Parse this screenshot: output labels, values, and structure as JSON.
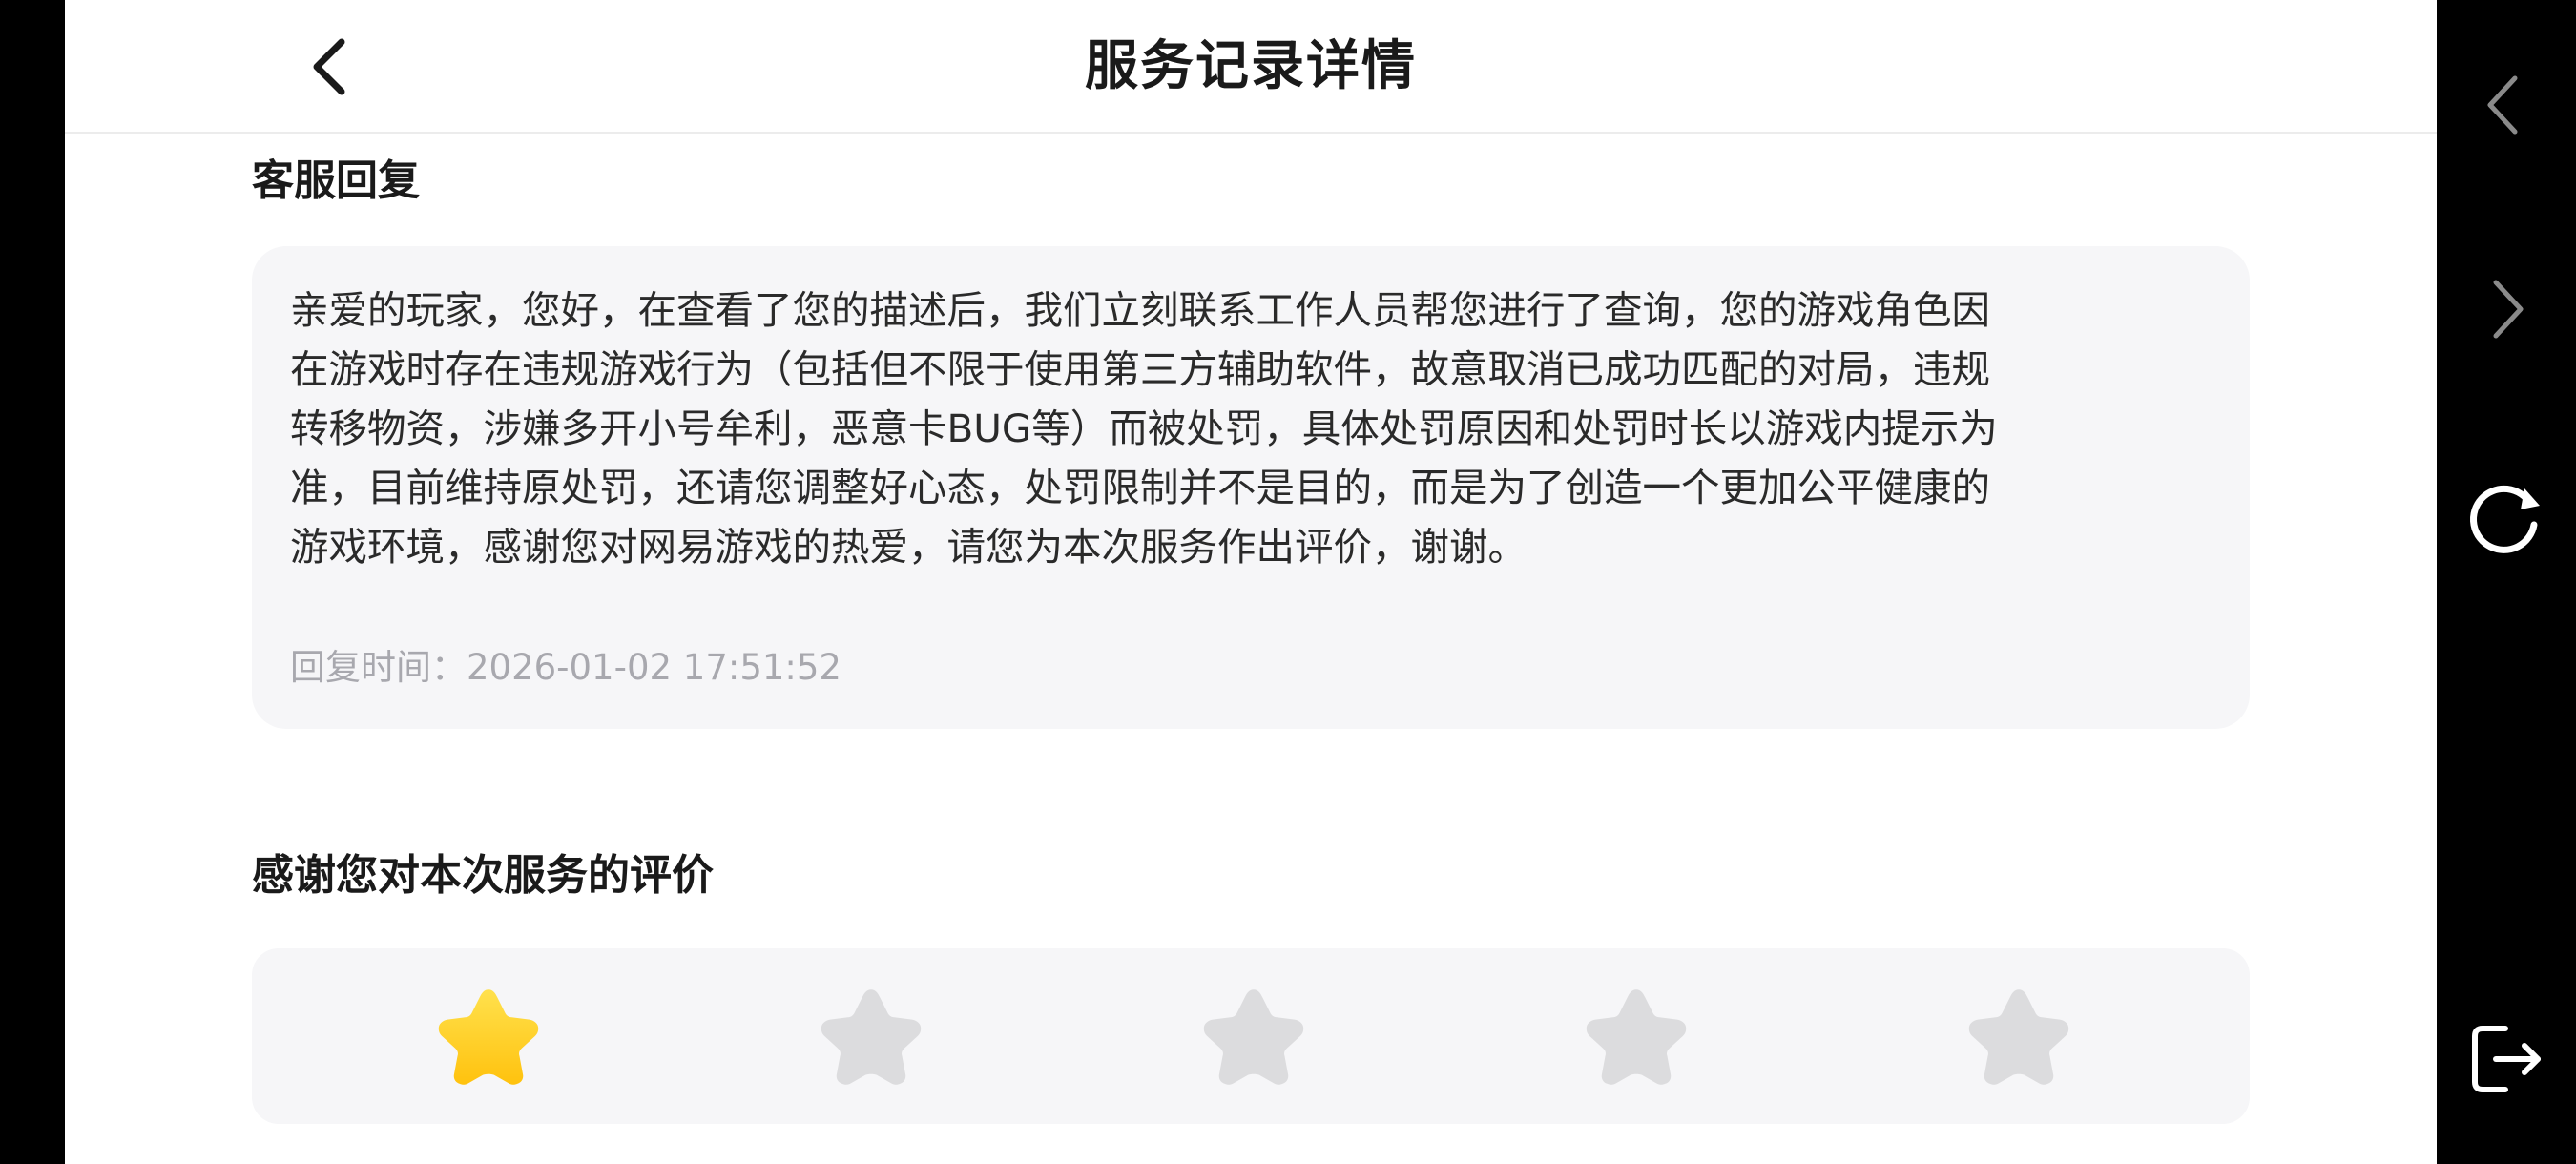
{
  "header": {
    "title": "服务记录详情",
    "back_icon": "chevron-left-icon"
  },
  "reply_section": {
    "title": "客服回复",
    "lines": [
      "亲爱的玩家，您好，在查看了您的描述后，我们立刻联系工作人员帮您进行了查询，您的游戏角色因",
      "在游戏时存在违规游戏行为（包括但不限于使用第三方辅助软件，故意取消已成功匹配的对局，违规",
      "转移物资，涉嫌多开小号牟利，恶意卡BUG等）而被处罚，具体处罚原因和处罚时长以游戏内提示为",
      "准，目前维持原处罚，还请您调整好心态，处罚限制并不是目的，而是为了创造一个更加公平健康的",
      "游戏环境，感谢您对网易游戏的热爱，请您为本次服务作出评价，谢谢。"
    ],
    "time_label": "回复时间：",
    "time_value": "2026-01-02 17:51:52"
  },
  "rating_section": {
    "title": "感谢您对本次服务的评价",
    "rating": 1,
    "max": 5,
    "icon": "star-icon",
    "colors": {
      "active": "#ffc20e",
      "active_light": "#ffe14d",
      "inactive": "#dcdcde"
    }
  },
  "system_bar": {
    "icons": [
      "nav-back-icon",
      "nav-forward-icon",
      "refresh-icon",
      "exit-icon"
    ],
    "color": "#8a8a8a"
  }
}
